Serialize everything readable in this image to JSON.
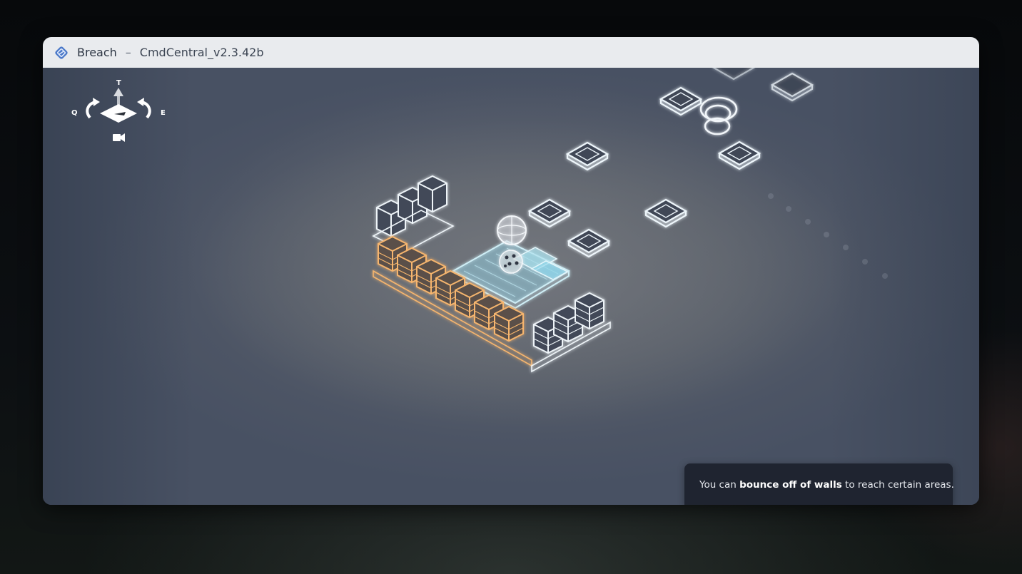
{
  "window": {
    "app_name": "Breach",
    "separator": "–",
    "file_name": "CmdCentral_v2.3.42b",
    "icon": "breach-diamond-icon"
  },
  "camera_controls": {
    "up_key": "T",
    "rotate_left_key": "Q",
    "rotate_right_key": "E",
    "icons": [
      "arrow-up-icon",
      "rotate-left-icon",
      "rotate-right-icon",
      "camera-icon"
    ]
  },
  "hint": {
    "prefix": "You can ",
    "emphasis": "bounce off of walls",
    "suffix": " to reach certain areas.",
    "progress": 1.0
  },
  "colors": {
    "accent_orange": "#f6b56e",
    "hologram_white": "#e8f2f8",
    "tile_cyan": "#8fd6ea",
    "viewport_bg": "#4b5363",
    "hint_bg": "#1f2430"
  }
}
